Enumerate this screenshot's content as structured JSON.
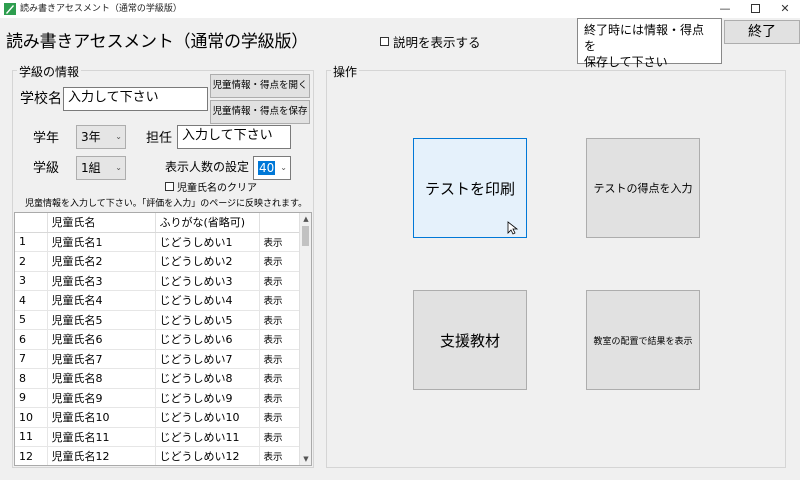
{
  "window": {
    "title": "読み書きアセスメント（通常の学級版）",
    "minimize_glyph": "—",
    "close_glyph": "✕",
    "icon": "app-logo-icon"
  },
  "header": {
    "title": "読み書きアセスメント（通常の学級版）",
    "show_description_label": "説明を表示する",
    "notice_line1": "終了時には情報・得点を",
    "notice_line2": "保存して下さい",
    "exit_label": "終了"
  },
  "class_info": {
    "legend": "学級の情報",
    "school_label": "学校名",
    "school_value": "入力して下さい",
    "open_button": "児童情報・得点を開く",
    "save_button": "児童情報・得点を保存",
    "grade_label": "学年",
    "grade_value": "3年",
    "teacher_label": "担任",
    "teacher_value": "入力して下さい",
    "class_label": "学級",
    "class_value": "1組",
    "count_label": "表示人数の設定",
    "count_value": "40",
    "clear_names_label": "児童氏名のクリア",
    "hint": "児童情報を入力して下さい。「評価を入力」のページに反映されます。"
  },
  "student_table": {
    "columns": [
      "",
      "児童氏名",
      "ふりがな(省略可)",
      ""
    ],
    "rows": [
      {
        "no": "1",
        "name": "児童氏名1",
        "kana": "じどうしめい1",
        "action": "表示"
      },
      {
        "no": "2",
        "name": "児童氏名2",
        "kana": "じどうしめい2",
        "action": "表示"
      },
      {
        "no": "3",
        "name": "児童氏名3",
        "kana": "じどうしめい3",
        "action": "表示"
      },
      {
        "no": "4",
        "name": "児童氏名4",
        "kana": "じどうしめい4",
        "action": "表示"
      },
      {
        "no": "5",
        "name": "児童氏名5",
        "kana": "じどうしめい5",
        "action": "表示"
      },
      {
        "no": "6",
        "name": "児童氏名6",
        "kana": "じどうしめい6",
        "action": "表示"
      },
      {
        "no": "7",
        "name": "児童氏名7",
        "kana": "じどうしめい7",
        "action": "表示"
      },
      {
        "no": "8",
        "name": "児童氏名8",
        "kana": "じどうしめい8",
        "action": "表示"
      },
      {
        "no": "9",
        "name": "児童氏名9",
        "kana": "じどうしめい9",
        "action": "表示"
      },
      {
        "no": "10",
        "name": "児童氏名10",
        "kana": "じどうしめい10",
        "action": "表示"
      },
      {
        "no": "11",
        "name": "児童氏名11",
        "kana": "じどうしめい11",
        "action": "表示"
      },
      {
        "no": "12",
        "name": "児童氏名12",
        "kana": "じどうしめい12",
        "action": "表示"
      }
    ]
  },
  "operations": {
    "legend": "操作",
    "print_test": "テストを印刷",
    "enter_scores": "テストの得点を入力",
    "support_materials": "支援教材",
    "seating_results": "教室の配置で結果を表示"
  },
  "colors": {
    "hover_bg": "#e5f1fb",
    "hover_border": "#0078d7",
    "selection": "#0078d7"
  }
}
